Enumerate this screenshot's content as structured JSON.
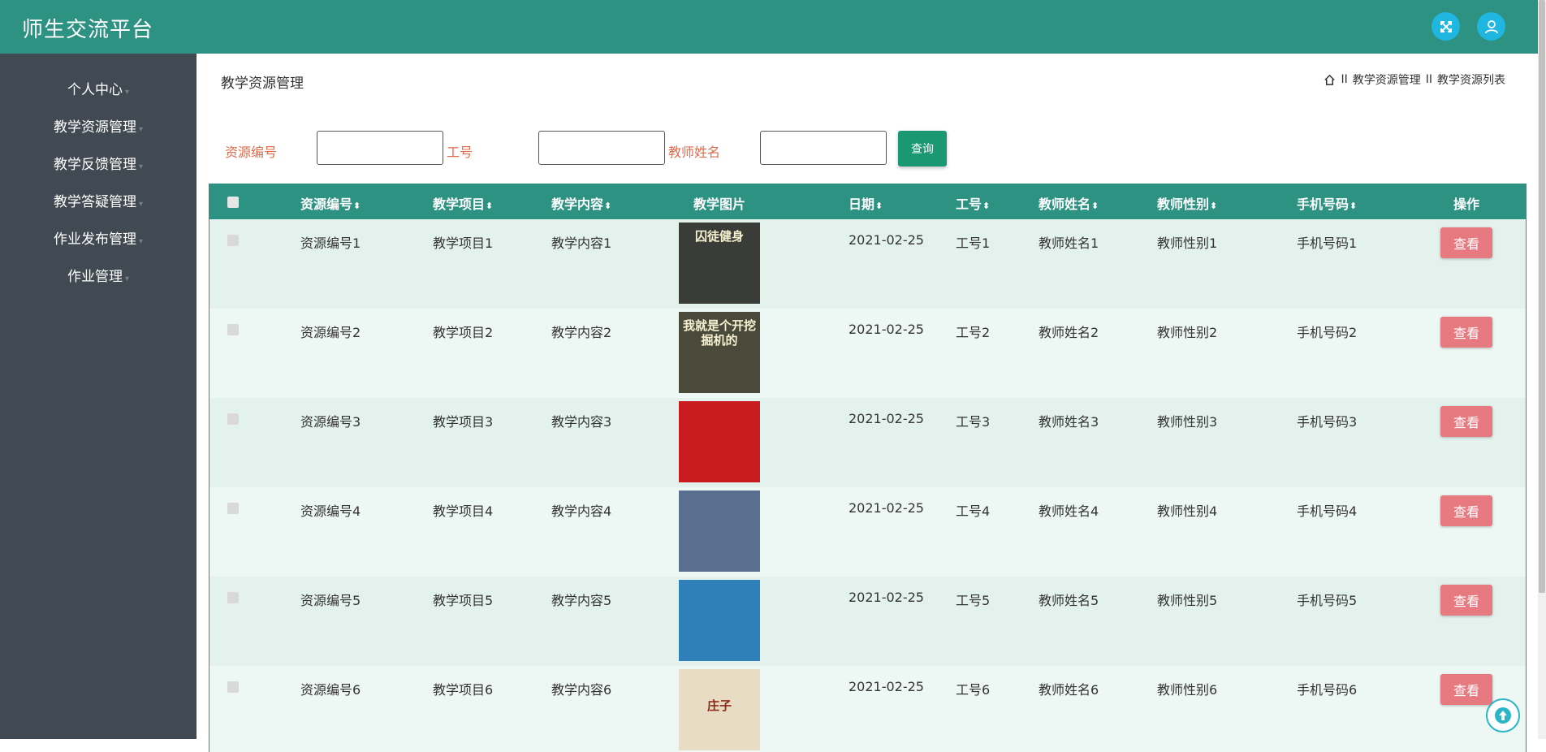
{
  "app": {
    "title": "师生交流平台"
  },
  "header_icons": [
    "fullscreen-icon",
    "user-icon"
  ],
  "sidebar": {
    "items": [
      {
        "label": "个人中心"
      },
      {
        "label": "教学资源管理"
      },
      {
        "label": "教学反馈管理"
      },
      {
        "label": "教学答疑管理"
      },
      {
        "label": "作业发布管理"
      },
      {
        "label": "作业管理"
      }
    ]
  },
  "page": {
    "title": "教学资源管理",
    "breadcrumb": [
      "教学资源管理",
      "教学资源列表"
    ],
    "breadcrumb_sep": "II"
  },
  "search": {
    "fields": [
      {
        "label": "资源编号",
        "value": ""
      },
      {
        "label": "工号",
        "value": ""
      },
      {
        "label": "教师姓名",
        "value": ""
      }
    ],
    "button": "查询"
  },
  "table": {
    "columns": [
      "资源编号",
      "教学项目",
      "教学内容",
      "教学图片",
      "日期",
      "工号",
      "教师姓名",
      "教师性别",
      "手机号码",
      "操作"
    ],
    "sort_glyph": "⬍",
    "rows": [
      {
        "id": "资源编号1",
        "project": "教学项目1",
        "content": "教学内容1",
        "date": "2021-02-25",
        "no": "工号1",
        "name": "教师姓名1",
        "gender": "教师性别1",
        "phone": "手机号码1",
        "action": "查看",
        "img_text": "囚徒健身",
        "img_color": "#3a3d37"
      },
      {
        "id": "资源编号2",
        "project": "教学项目2",
        "content": "教学内容2",
        "date": "2021-02-25",
        "no": "工号2",
        "name": "教师姓名2",
        "gender": "教师性别2",
        "phone": "手机号码2",
        "action": "查看",
        "img_text": "我就是个开挖掘机的",
        "img_color": "#4a4a3a"
      },
      {
        "id": "资源编号3",
        "project": "教学项目3",
        "content": "教学内容3",
        "date": "2021-02-25",
        "no": "工号3",
        "name": "教师姓名3",
        "gender": "教师性别3",
        "phone": "手机号码3",
        "action": "查看",
        "img_text": "",
        "img_color": "#c81c20"
      },
      {
        "id": "资源编号4",
        "project": "教学项目4",
        "content": "教学内容4",
        "date": "2021-02-25",
        "no": "工号4",
        "name": "教师姓名4",
        "gender": "教师性别4",
        "phone": "手机号码4",
        "action": "查看",
        "img_text": "",
        "img_color": "#5a6f8f"
      },
      {
        "id": "资源编号5",
        "project": "教学项目5",
        "content": "教学内容5",
        "date": "2021-02-25",
        "no": "工号5",
        "name": "教师姓名5",
        "gender": "教师性别5",
        "phone": "手机号码5",
        "action": "查看",
        "img_text": "",
        "img_color": "#2f7fb8"
      },
      {
        "id": "资源编号6",
        "project": "教学项目6",
        "content": "教学内容6",
        "date": "2021-02-25",
        "no": "工号6",
        "name": "教师姓名6",
        "gender": "教师性别6",
        "phone": "手机号码6",
        "action": "查看",
        "img_text": "庄子",
        "img_color": "#e9dcc5"
      }
    ]
  },
  "colors": {
    "header": "#2e9283",
    "sidebar": "#414a52",
    "label": "#e06b4c",
    "search_button": "#1a9871",
    "view_button": "#e77a80"
  }
}
